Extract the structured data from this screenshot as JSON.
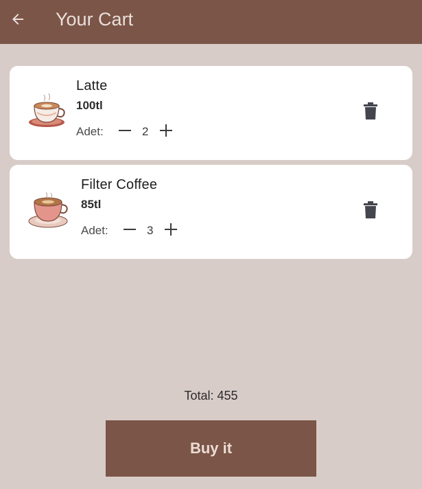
{
  "appbar": {
    "title": "Your Cart",
    "back_icon": "arrow-left-icon",
    "background": "#7b5547",
    "title_color": "#eadfdc"
  },
  "cart": {
    "items": [
      {
        "name": "Latte",
        "price": "100tl",
        "qty_label": "Adet:",
        "qty": "2",
        "image_icon": "coffee-cup-icon",
        "delete_icon": "trash-icon",
        "minus_icon": "minus-icon",
        "plus_icon": "plus-icon"
      },
      {
        "name": "Filter Coffee",
        "price": "85tl",
        "qty_label": "Adet:",
        "qty": "3",
        "image_icon": "coffee-cup-icon",
        "delete_icon": "trash-icon",
        "minus_icon": "minus-icon",
        "plus_icon": "plus-icon"
      }
    ]
  },
  "footer": {
    "total": "Total: 455",
    "buy_label": "Buy it",
    "button_color": "#7b5547"
  },
  "colors": {
    "background": "#d8ccc8",
    "card": "#ffffff"
  }
}
